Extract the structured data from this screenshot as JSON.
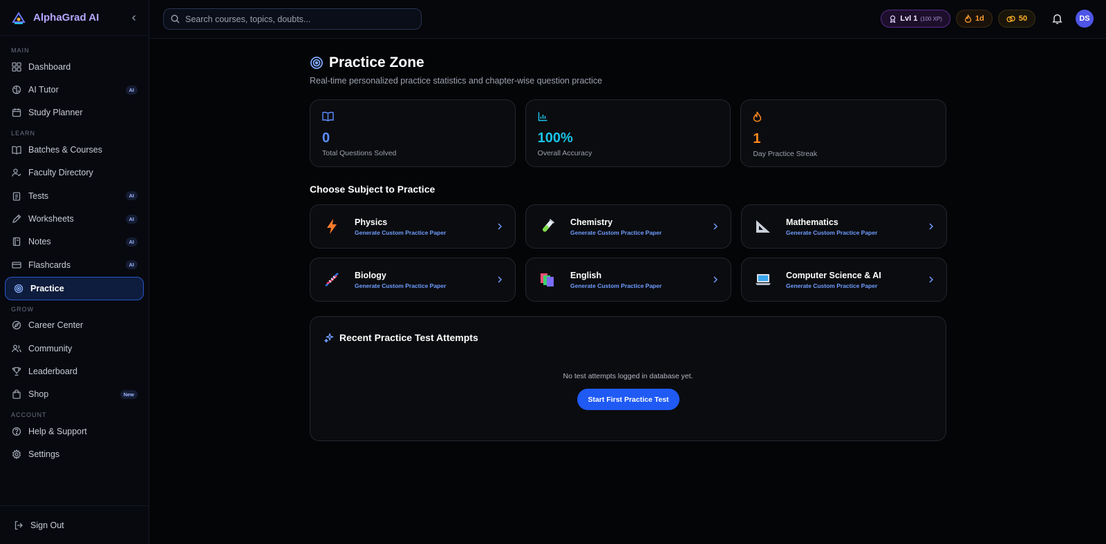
{
  "brand": {
    "name": "AlphaGrad AI",
    "logo": "alphagrad-logo"
  },
  "sidebar": {
    "sections": {
      "main": "MAIN",
      "learn": "LEARN",
      "grow": "GROW",
      "account": "ACCOUNT"
    },
    "items": {
      "dashboard": {
        "label": "Dashboard",
        "icon": "grid-icon"
      },
      "ai_tutor": {
        "label": "AI Tutor",
        "icon": "brain-icon",
        "badge": "AI"
      },
      "study_planner": {
        "label": "Study Planner",
        "icon": "calendar-icon"
      },
      "batches": {
        "label": "Batches & Courses",
        "icon": "book-icon"
      },
      "faculty": {
        "label": "Faculty Directory",
        "icon": "user-check-icon"
      },
      "tests": {
        "label": "Tests",
        "icon": "clipboard-icon",
        "badge": "AI"
      },
      "worksheets": {
        "label": "Worksheets",
        "icon": "pen-icon",
        "badge": "AI"
      },
      "notes": {
        "label": "Notes",
        "icon": "notebook-icon",
        "badge": "AI"
      },
      "flashcards": {
        "label": "Flashcards",
        "icon": "card-icon",
        "badge": "AI"
      },
      "practice": {
        "label": "Practice",
        "icon": "target-icon"
      },
      "career": {
        "label": "Career Center",
        "icon": "compass-icon"
      },
      "community": {
        "label": "Community",
        "icon": "users-icon"
      },
      "leaderboard": {
        "label": "Leaderboard",
        "icon": "trophy-icon"
      },
      "shop": {
        "label": "Shop",
        "icon": "bag-icon",
        "badge": "New"
      },
      "help": {
        "label": "Help & Support",
        "icon": "help-icon"
      },
      "settings": {
        "label": "Settings",
        "icon": "gear-icon"
      }
    },
    "signout": "Sign Out"
  },
  "topbar": {
    "search_placeholder": "Search courses, topics, doubts...",
    "level": "Lvl 1",
    "xp": "(100 XP)",
    "streak": "1d",
    "coins": "50",
    "avatar": "DS"
  },
  "page": {
    "title": "Practice Zone",
    "subtitle": "Real-time personalized practice statistics and chapter-wise question practice"
  },
  "stats": [
    {
      "value": "0",
      "label": "Total Questions Solved",
      "color": "#5b8dff",
      "icon": "book-open-icon"
    },
    {
      "value": "100%",
      "label": "Overall Accuracy",
      "color": "#19c3e6",
      "icon": "bar-chart-icon"
    },
    {
      "value": "1",
      "label": "Day Practice Streak",
      "color": "#ff8a1f",
      "icon": "flame-icon"
    }
  ],
  "subjects_title": "Choose Subject to Practice",
  "subjects": [
    {
      "name": "Physics",
      "desc": "Generate Custom Practice Paper",
      "icon": "lightning-icon"
    },
    {
      "name": "Chemistry",
      "desc": "Generate Custom Practice Paper",
      "icon": "test-tube-icon"
    },
    {
      "name": "Mathematics",
      "desc": "Generate Custom Practice Paper",
      "icon": "triangle-ruler-icon"
    },
    {
      "name": "Biology",
      "desc": "Generate Custom Practice Paper",
      "icon": "dna-icon"
    },
    {
      "name": "English",
      "desc": "Generate Custom Practice Paper",
      "icon": "books-icon"
    },
    {
      "name": "Computer Science & AI",
      "desc": "Generate Custom Practice Paper",
      "icon": "laptop-icon"
    }
  ],
  "recent": {
    "title": "Recent Practice Test Attempts",
    "empty": "No test attempts logged in database yet.",
    "button": "Start First Practice Test"
  }
}
